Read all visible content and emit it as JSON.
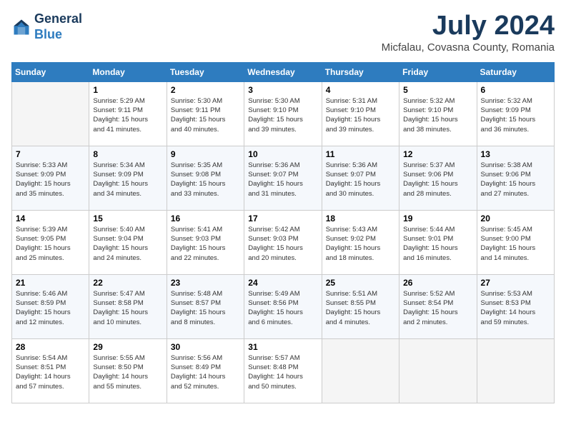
{
  "header": {
    "logo_line1": "General",
    "logo_line2": "Blue",
    "month": "July 2024",
    "location": "Micfalau, Covasna County, Romania"
  },
  "days_of_week": [
    "Sunday",
    "Monday",
    "Tuesday",
    "Wednesday",
    "Thursday",
    "Friday",
    "Saturday"
  ],
  "weeks": [
    [
      {
        "day": "",
        "info": ""
      },
      {
        "day": "1",
        "info": "Sunrise: 5:29 AM\nSunset: 9:11 PM\nDaylight: 15 hours\nand 41 minutes."
      },
      {
        "day": "2",
        "info": "Sunrise: 5:30 AM\nSunset: 9:11 PM\nDaylight: 15 hours\nand 40 minutes."
      },
      {
        "day": "3",
        "info": "Sunrise: 5:30 AM\nSunset: 9:10 PM\nDaylight: 15 hours\nand 39 minutes."
      },
      {
        "day": "4",
        "info": "Sunrise: 5:31 AM\nSunset: 9:10 PM\nDaylight: 15 hours\nand 39 minutes."
      },
      {
        "day": "5",
        "info": "Sunrise: 5:32 AM\nSunset: 9:10 PM\nDaylight: 15 hours\nand 38 minutes."
      },
      {
        "day": "6",
        "info": "Sunrise: 5:32 AM\nSunset: 9:09 PM\nDaylight: 15 hours\nand 36 minutes."
      }
    ],
    [
      {
        "day": "7",
        "info": "Sunrise: 5:33 AM\nSunset: 9:09 PM\nDaylight: 15 hours\nand 35 minutes."
      },
      {
        "day": "8",
        "info": "Sunrise: 5:34 AM\nSunset: 9:09 PM\nDaylight: 15 hours\nand 34 minutes."
      },
      {
        "day": "9",
        "info": "Sunrise: 5:35 AM\nSunset: 9:08 PM\nDaylight: 15 hours\nand 33 minutes."
      },
      {
        "day": "10",
        "info": "Sunrise: 5:36 AM\nSunset: 9:07 PM\nDaylight: 15 hours\nand 31 minutes."
      },
      {
        "day": "11",
        "info": "Sunrise: 5:36 AM\nSunset: 9:07 PM\nDaylight: 15 hours\nand 30 minutes."
      },
      {
        "day": "12",
        "info": "Sunrise: 5:37 AM\nSunset: 9:06 PM\nDaylight: 15 hours\nand 28 minutes."
      },
      {
        "day": "13",
        "info": "Sunrise: 5:38 AM\nSunset: 9:06 PM\nDaylight: 15 hours\nand 27 minutes."
      }
    ],
    [
      {
        "day": "14",
        "info": "Sunrise: 5:39 AM\nSunset: 9:05 PM\nDaylight: 15 hours\nand 25 minutes."
      },
      {
        "day": "15",
        "info": "Sunrise: 5:40 AM\nSunset: 9:04 PM\nDaylight: 15 hours\nand 24 minutes."
      },
      {
        "day": "16",
        "info": "Sunrise: 5:41 AM\nSunset: 9:03 PM\nDaylight: 15 hours\nand 22 minutes."
      },
      {
        "day": "17",
        "info": "Sunrise: 5:42 AM\nSunset: 9:03 PM\nDaylight: 15 hours\nand 20 minutes."
      },
      {
        "day": "18",
        "info": "Sunrise: 5:43 AM\nSunset: 9:02 PM\nDaylight: 15 hours\nand 18 minutes."
      },
      {
        "day": "19",
        "info": "Sunrise: 5:44 AM\nSunset: 9:01 PM\nDaylight: 15 hours\nand 16 minutes."
      },
      {
        "day": "20",
        "info": "Sunrise: 5:45 AM\nSunset: 9:00 PM\nDaylight: 15 hours\nand 14 minutes."
      }
    ],
    [
      {
        "day": "21",
        "info": "Sunrise: 5:46 AM\nSunset: 8:59 PM\nDaylight: 15 hours\nand 12 minutes."
      },
      {
        "day": "22",
        "info": "Sunrise: 5:47 AM\nSunset: 8:58 PM\nDaylight: 15 hours\nand 10 minutes."
      },
      {
        "day": "23",
        "info": "Sunrise: 5:48 AM\nSunset: 8:57 PM\nDaylight: 15 hours\nand 8 minutes."
      },
      {
        "day": "24",
        "info": "Sunrise: 5:49 AM\nSunset: 8:56 PM\nDaylight: 15 hours\nand 6 minutes."
      },
      {
        "day": "25",
        "info": "Sunrise: 5:51 AM\nSunset: 8:55 PM\nDaylight: 15 hours\nand 4 minutes."
      },
      {
        "day": "26",
        "info": "Sunrise: 5:52 AM\nSunset: 8:54 PM\nDaylight: 15 hours\nand 2 minutes."
      },
      {
        "day": "27",
        "info": "Sunrise: 5:53 AM\nSunset: 8:53 PM\nDaylight: 14 hours\nand 59 minutes."
      }
    ],
    [
      {
        "day": "28",
        "info": "Sunrise: 5:54 AM\nSunset: 8:51 PM\nDaylight: 14 hours\nand 57 minutes."
      },
      {
        "day": "29",
        "info": "Sunrise: 5:55 AM\nSunset: 8:50 PM\nDaylight: 14 hours\nand 55 minutes."
      },
      {
        "day": "30",
        "info": "Sunrise: 5:56 AM\nSunset: 8:49 PM\nDaylight: 14 hours\nand 52 minutes."
      },
      {
        "day": "31",
        "info": "Sunrise: 5:57 AM\nSunset: 8:48 PM\nDaylight: 14 hours\nand 50 minutes."
      },
      {
        "day": "",
        "info": ""
      },
      {
        "day": "",
        "info": ""
      },
      {
        "day": "",
        "info": ""
      }
    ]
  ]
}
